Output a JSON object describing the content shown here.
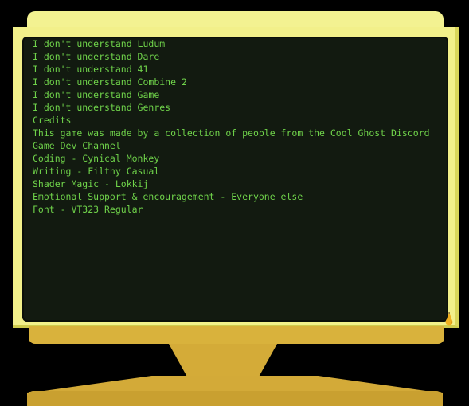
{
  "console": {
    "lines": [
      "I don't understand Ludum",
      "I don't understand Dare",
      "I don't understand 41",
      "I don't understand Combine 2",
      "I don't understand Game",
      "I don't understand Genres",
      "Credits",
      "This game was made by a collection of people from the Cool Ghost Discord Game Dev Channel",
      "Coding - Cynical Monkey",
      "Writing - Filthy Casual",
      "Shader Magic - Lokkij",
      "Emotional Support & encouragement - Everyone else",
      "Font - VT323 Regular"
    ],
    "text_color": "#6fd24a",
    "background_color": "#121a10"
  },
  "monitor": {
    "frame_color": "#f2f08a",
    "stand_color": "#d4ab38"
  },
  "icons": {
    "corner": "pear-icon"
  }
}
